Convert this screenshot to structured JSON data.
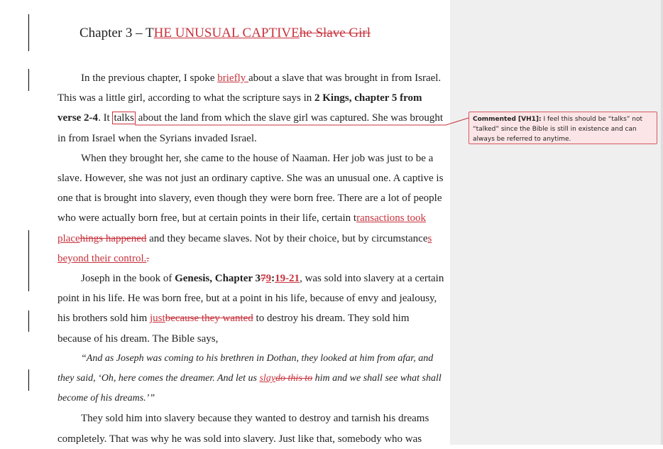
{
  "document": {
    "title_prefix": "Chapter 3 – T",
    "title_inserted": "HE UNUSUAL CAPTIVE",
    "title_deleted": "he Slave Girl",
    "p1": {
      "t1": "In the previous chapter, I spoke ",
      "ins1": "briefly ",
      "t2": "about a slave that was brought in from Israel. This was a little girl, according to what the scripture says in ",
      "b1": "2 Kings, chapter 5 from verse 2-4",
      "t3": ". It ",
      "anchor": "talks",
      "t4": " about the land from which the slave girl was captured. She was brought in from Israel when the Syrians invaded Israel."
    },
    "p2": {
      "t1": "When they brought her, she came to the house of Naaman. Her job was just to be a slave. However, she was not just an ordinary captive. She was an unusual one. A captive is one that is brought into slavery, even though they were born free. There are a lot of people who were actually born free, but at certain points in their life, certain t",
      "ins1": "ransactions took place",
      "del1": "hings happened",
      "t2": " and they became slaves. Not by their choice, but by circumstance",
      "ins2": "s beyond their control.",
      "del2": "."
    },
    "p3": {
      "t1": "Joseph in the book of ",
      "b1": "Genesis, Chapter 3",
      "del1": "7",
      "ins1": "9",
      "b2": ":",
      "ins2": "19-21",
      "t2": ", was sold into slavery at a certain point in his life. He was born free, but at a point in his life, because of envy and jealousy, his brothers sold him ",
      "ins3": "just",
      "del3": "because they wanted",
      "t3": " to destroy his dream. They sold him because of his dream. The Bible says,"
    },
    "quote": {
      "t1": "“And as Joseph was coming to his brethren in Dothan, they looked at him from afar, and they said, ‘Oh, here comes the dreamer. And let us ",
      "ins1": "slay",
      "del1": "do this to",
      "t2": " him and we shall see what shall become of his dreams.’”"
    },
    "p4": {
      "t1": "They sold him into slavery because they wanted to destroy and tarnish his dreams completely. That was why he was sold into slavery. Just like that, somebody who was"
    }
  },
  "comment": {
    "author": "Commented [VH1]:",
    "text": " I feel this should be “talks” not “talked” since the Bible is still in existence and can always be referred to anytime."
  },
  "colors": {
    "revision": "#c8323c",
    "comment_bg": "#fbe5e6",
    "comment_border": "#d55a62",
    "markup_pane": "#efefef"
  }
}
